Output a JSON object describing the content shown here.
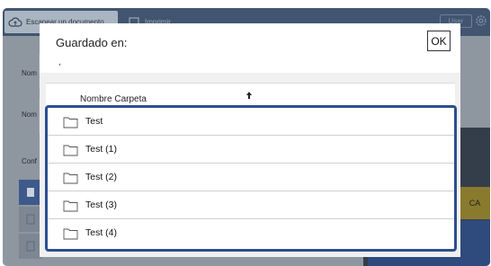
{
  "topbar": {
    "tabs": [
      {
        "label": "Escanear un documento",
        "icon": "cloud-scan-icon"
      },
      {
        "label": "Imprimir",
        "icon": "print-icon"
      }
    ],
    "user_label": "User",
    "settings_icon": "gear-icon"
  },
  "background": {
    "labels": [
      "Nom",
      "Nom",
      "Conf"
    ],
    "action_label": "CA"
  },
  "dialog": {
    "title": "Guardado en:",
    "ok_label": "OK",
    "path": ",",
    "column_header": "Nombre Carpeta",
    "sort_icon": "sort-arrow-up-icon",
    "folders": [
      {
        "name": "Test"
      },
      {
        "name": "Test (1)"
      },
      {
        "name": "Test (2)"
      },
      {
        "name": "Test (3)"
      },
      {
        "name": "Test (4)"
      }
    ]
  },
  "colors": {
    "dim_overlay": "#8e96a0",
    "topbar": "#415570",
    "selection_border": "#2c4f8f",
    "accent_button": "#8a7a2e"
  }
}
